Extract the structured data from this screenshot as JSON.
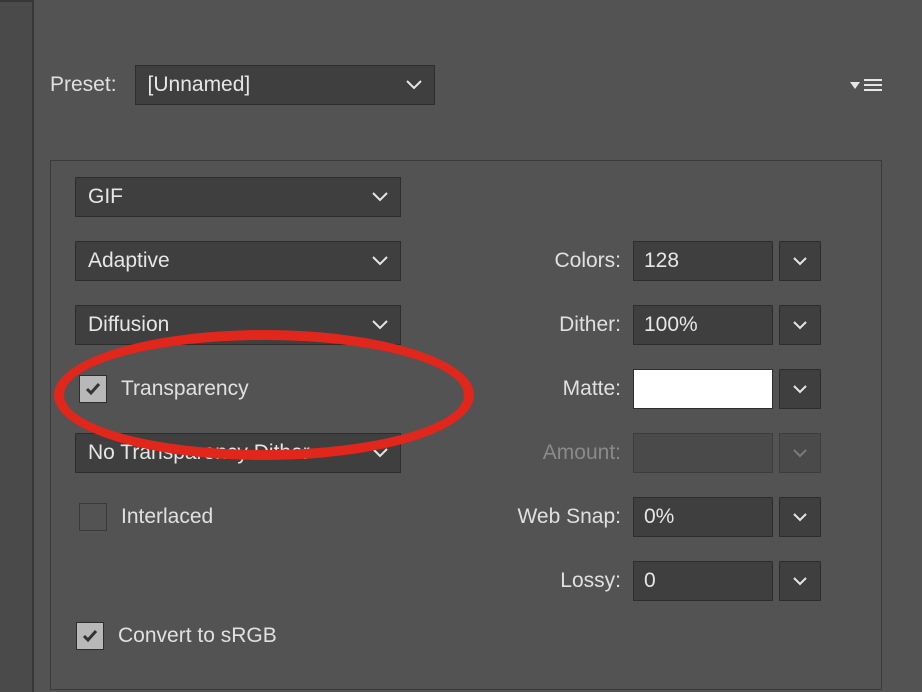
{
  "preset": {
    "label": "Preset:",
    "value": "[Unnamed]"
  },
  "format": {
    "value": "GIF"
  },
  "colorReduction": {
    "value": "Adaptive"
  },
  "ditherAlgo": {
    "value": "Diffusion"
  },
  "transparency": {
    "label": "Transparency",
    "checked": true
  },
  "transparencyDither": {
    "value": "No Transparency Dither"
  },
  "interlaced": {
    "label": "Interlaced",
    "checked": false
  },
  "colors": {
    "label": "Colors:",
    "value": "128"
  },
  "dither": {
    "label": "Dither:",
    "value": "100%"
  },
  "matte": {
    "label": "Matte:",
    "swatch": "#ffffff"
  },
  "amount": {
    "label": "Amount:",
    "value": "",
    "enabled": false
  },
  "webSnap": {
    "label": "Web Snap:",
    "value": "0%"
  },
  "lossy": {
    "label": "Lossy:",
    "value": "0"
  },
  "convertSRGB": {
    "label": "Convert to sRGB",
    "checked": true
  },
  "annotationColor": "#e1261c"
}
